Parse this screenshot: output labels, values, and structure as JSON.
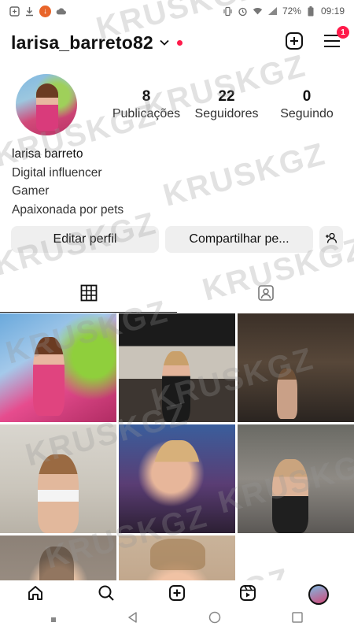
{
  "status_bar": {
    "battery": "72%",
    "time": "09:19"
  },
  "header": {
    "username": "larisa_barreto82",
    "notification_count": "1"
  },
  "profile": {
    "stats": [
      {
        "value": "8",
        "label": "Publicações"
      },
      {
        "value": "22",
        "label": "Seguidores"
      },
      {
        "value": "0",
        "label": "Seguindo"
      }
    ],
    "bio": {
      "name": "larisa barreto",
      "lines": [
        "Digital influencer",
        "Gamer",
        "Apaixonada por pets"
      ]
    }
  },
  "actions": {
    "edit_profile": "Editar perfil",
    "share_profile": "Compartilhar pe..."
  },
  "watermark": "KRUSKGZ",
  "icons": {
    "status_left": [
      "screenshot-icon",
      "download-icon",
      "download-badge-icon",
      "cloud-icon"
    ],
    "status_right": [
      "vibrate-icon",
      "alarm-icon",
      "wifi-icon",
      "signal-icon",
      "battery-icon"
    ],
    "header": [
      "chevron-down-icon",
      "new-post-icon",
      "menu-icon"
    ],
    "tabs": [
      "grid-icon",
      "tagged-icon"
    ],
    "bottom_nav": [
      "home-icon",
      "search-icon",
      "create-icon",
      "reels-icon",
      "profile-avatar"
    ],
    "system_nav": [
      "recent-apps-icon",
      "back-icon",
      "home-circle-icon",
      "overview-icon"
    ]
  },
  "colors": {
    "accent_red": "#ff1a4a",
    "button_bg": "#efefef"
  }
}
